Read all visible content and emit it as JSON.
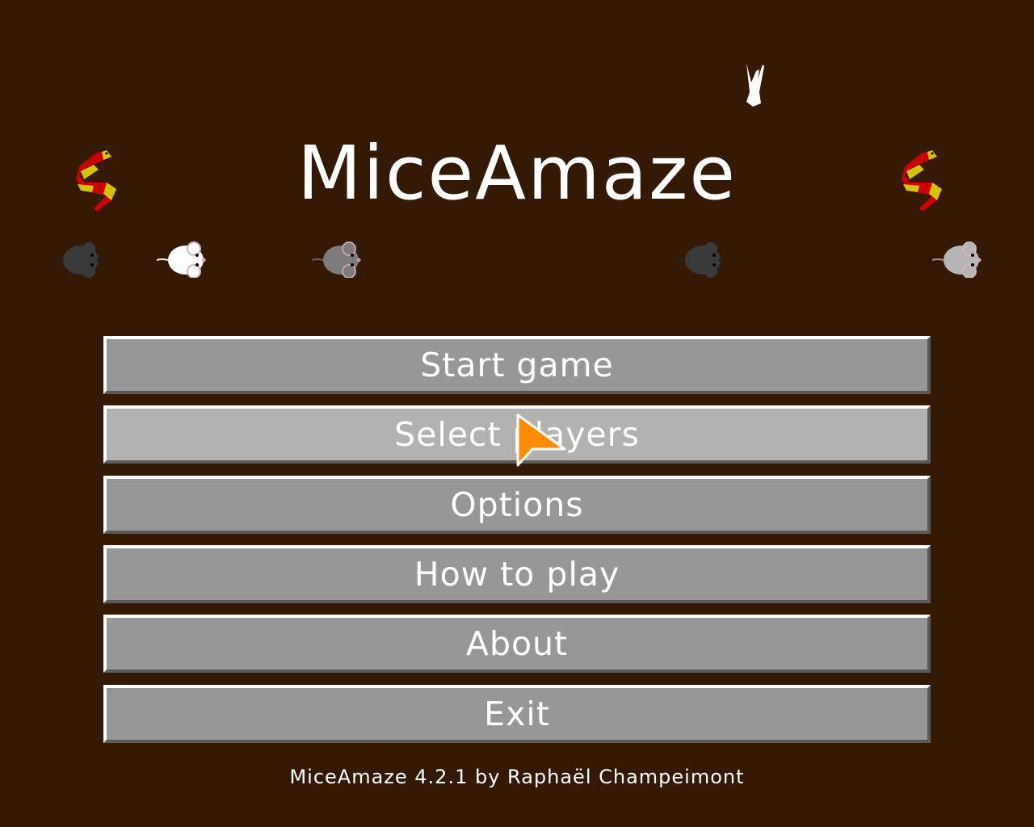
{
  "title": "MiceAmaze",
  "menu": {
    "items": [
      {
        "label": "Start game",
        "hovered": false
      },
      {
        "label": "Select players",
        "hovered": true
      },
      {
        "label": "Options",
        "hovered": false
      },
      {
        "label": "How to play",
        "hovered": false
      },
      {
        "label": "About",
        "hovered": false
      },
      {
        "label": "Exit",
        "hovered": false
      }
    ]
  },
  "footer": "MiceAmaze 4.2.1 by Raphaël Champeimont",
  "colors": {
    "background": "#341a04",
    "button": "#979797",
    "button_hover": "#b2b2b2",
    "text": "#ffffff",
    "cursor": "#ff8c00"
  },
  "sprites": {
    "snakes": [
      "snake-icon",
      "snake-icon"
    ],
    "mice": [
      "dark-gray-mouse-icon",
      "white-mouse-icon",
      "gray-mouse-icon",
      "dark-gray-mouse-icon",
      "light-gray-mouse-icon"
    ],
    "hand": "white-hand-icon"
  }
}
